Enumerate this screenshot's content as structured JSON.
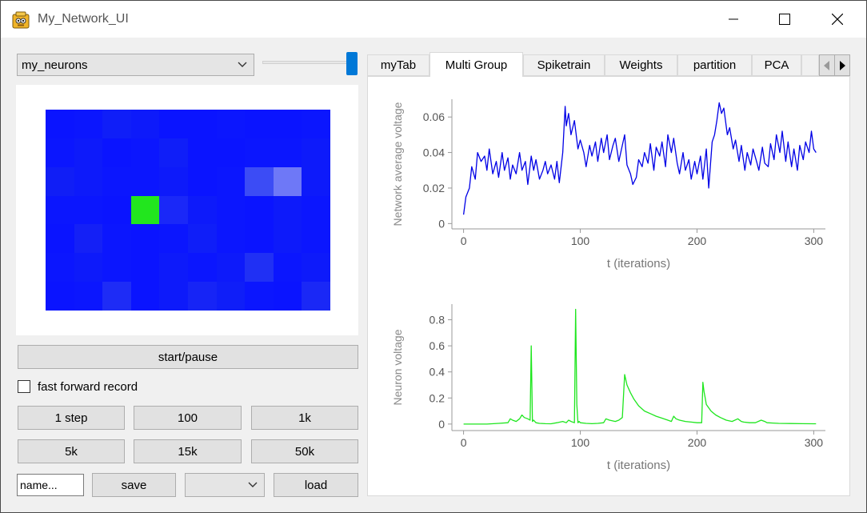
{
  "window": {
    "title": "My_Network_UI"
  },
  "left": {
    "group_select": {
      "value": "my_neurons"
    },
    "slider": {
      "value_fraction": 1.0
    },
    "heatmap": {
      "rows": 7,
      "cols": 10,
      "cells": [
        [
          "#0a14ff",
          "#0b16fe",
          "#0f1ef8",
          "#0d1afa",
          "#0a14ff",
          "#0a14ff",
          "#0b16fe",
          "#0a14ff",
          "#0a14ff",
          "#0b16fe"
        ],
        [
          "#0b16fe",
          "#0d1afa",
          "#0a14ff",
          "#0b16fe",
          "#0f1ef8",
          "#0a14ff",
          "#0a14ff",
          "#0b16fe",
          "#0b16fe",
          "#0d1afa"
        ],
        [
          "#101ef6",
          "#0d1afa",
          "#0b16fe",
          "#0b16fe",
          "#0d1afa",
          "#0a14ff",
          "#0b16fe",
          "#3c4cf5",
          "#6e78f7",
          "#0d1afa"
        ],
        [
          "#0b16fe",
          "#0b16fe",
          "#0a14ff",
          "#22e61e",
          "#1a28f8",
          "#0d1afa",
          "#0b16fe",
          "#0a14ff",
          "#0d1afa",
          "#0b16fe"
        ],
        [
          "#0a14ff",
          "#1420f6",
          "#0b16fe",
          "#0a14ff",
          "#0b16fe",
          "#0f1ef8",
          "#0b16fe",
          "#0a14ff",
          "#0d1afa",
          "#0b16fe"
        ],
        [
          "#0b16fe",
          "#0d1afa",
          "#0b16fe",
          "#0a14ff",
          "#0d1afa",
          "#0b16fe",
          "#0d1afa",
          "#2030f4",
          "#0b16fe",
          "#0d1afa"
        ],
        [
          "#0a14ff",
          "#0b16fe",
          "#1e2cf6",
          "#0a14ff",
          "#0d1afa",
          "#1624f6",
          "#0f1ef8",
          "#0b16fe",
          "#0a14ff",
          "#1a28f6"
        ]
      ]
    },
    "start_pause_label": "start/pause",
    "fast_forward": {
      "label": "fast forward record",
      "checked": false
    },
    "step_buttons": [
      "1 step",
      "100",
      "1k",
      "5k",
      "15k",
      "50k"
    ],
    "name_field": {
      "value": "name..."
    },
    "save_label": "save",
    "file_select": {
      "value": ""
    },
    "load_label": "load"
  },
  "tabs": {
    "items": [
      "myTab",
      "Multi Group",
      "Spiketrain",
      "Weights",
      "partition",
      "PCA"
    ],
    "active": "Multi Group"
  },
  "colors": {
    "voltage_line": "#0000e6",
    "neuron_line": "#1ee61e",
    "highlight_neuron": "#22e61e",
    "slider_handle": "#0078d7"
  },
  "chart_data": [
    {
      "type": "line",
      "xlabel": "t (iterations)",
      "ylabel": "Network average voltage",
      "xlim": [
        -10,
        310
      ],
      "ylim": [
        -0.003,
        0.07
      ],
      "xticks": [
        0,
        100,
        200,
        300
      ],
      "yticks": [
        0,
        0.02,
        0.04,
        0.06
      ],
      "yticklabels": [
        "0",
        "0.02",
        "0.04",
        "0.06"
      ],
      "grid": false,
      "series": [
        {
          "color": "#0000e6",
          "x": [
            0,
            2,
            5,
            7,
            10,
            12,
            15,
            18,
            20,
            22,
            25,
            28,
            30,
            33,
            35,
            38,
            40,
            42,
            45,
            48,
            50,
            53,
            55,
            58,
            60,
            62,
            65,
            68,
            70,
            72,
            75,
            78,
            80,
            82,
            85,
            87,
            88,
            90,
            92,
            95,
            98,
            100,
            103,
            105,
            108,
            110,
            113,
            115,
            118,
            120,
            123,
            125,
            128,
            130,
            133,
            135,
            138,
            140,
            143,
            145,
            148,
            150,
            153,
            155,
            158,
            160,
            163,
            165,
            168,
            170,
            173,
            175,
            178,
            180,
            183,
            185,
            188,
            190,
            193,
            195,
            198,
            200,
            203,
            205,
            208,
            210,
            213,
            215,
            217,
            219,
            221,
            223,
            226,
            228,
            231,
            233,
            236,
            238,
            241,
            243,
            246,
            248,
            251,
            253,
            256,
            258,
            261,
            263,
            266,
            268,
            271,
            273,
            276,
            278,
            281,
            283,
            286,
            288,
            291,
            293,
            296,
            298,
            300,
            302
          ],
          "y": [
            0.005,
            0.015,
            0.02,
            0.032,
            0.025,
            0.04,
            0.035,
            0.038,
            0.03,
            0.042,
            0.028,
            0.035,
            0.026,
            0.04,
            0.03,
            0.037,
            0.025,
            0.033,
            0.028,
            0.04,
            0.03,
            0.035,
            0.022,
            0.038,
            0.03,
            0.036,
            0.025,
            0.03,
            0.035,
            0.028,
            0.033,
            0.025,
            0.035,
            0.023,
            0.04,
            0.066,
            0.055,
            0.062,
            0.05,
            0.058,
            0.042,
            0.047,
            0.04,
            0.032,
            0.044,
            0.038,
            0.046,
            0.035,
            0.048,
            0.04,
            0.05,
            0.036,
            0.044,
            0.048,
            0.035,
            0.041,
            0.05,
            0.033,
            0.028,
            0.022,
            0.026,
            0.036,
            0.032,
            0.04,
            0.034,
            0.045,
            0.03,
            0.043,
            0.038,
            0.046,
            0.032,
            0.05,
            0.04,
            0.048,
            0.034,
            0.028,
            0.04,
            0.03,
            0.036,
            0.025,
            0.035,
            0.028,
            0.038,
            0.025,
            0.042,
            0.02,
            0.046,
            0.05,
            0.058,
            0.068,
            0.062,
            0.065,
            0.05,
            0.054,
            0.042,
            0.047,
            0.035,
            0.044,
            0.03,
            0.04,
            0.033,
            0.042,
            0.035,
            0.03,
            0.043,
            0.034,
            0.032,
            0.045,
            0.036,
            0.05,
            0.04,
            0.052,
            0.035,
            0.046,
            0.032,
            0.042,
            0.03,
            0.044,
            0.036,
            0.046,
            0.04,
            0.052,
            0.042,
            0.04
          ]
        }
      ]
    },
    {
      "type": "line",
      "xlabel": "t (iterations)",
      "ylabel": "Neuron voltage",
      "xlim": [
        -10,
        310
      ],
      "ylim": [
        -0.05,
        0.92
      ],
      "xticks": [
        0,
        100,
        200,
        300
      ],
      "yticks": [
        0,
        0.2,
        0.4,
        0.6,
        0.8
      ],
      "yticklabels": [
        "0",
        "0.2",
        "0.4",
        "0.6",
        "0.8"
      ],
      "grid": false,
      "series": [
        {
          "color": "#1ee61e",
          "x": [
            0,
            10,
            20,
            30,
            38,
            40,
            42,
            45,
            48,
            50,
            52,
            55,
            57,
            58,
            59,
            60,
            62,
            65,
            70,
            75,
            80,
            85,
            88,
            90,
            92,
            95,
            96,
            97,
            98,
            99,
            100,
            105,
            110,
            115,
            120,
            122,
            125,
            130,
            133,
            136,
            138,
            140,
            143,
            146,
            150,
            155,
            160,
            165,
            170,
            175,
            178,
            180,
            182,
            185,
            190,
            195,
            200,
            204,
            205,
            206,
            207,
            208,
            212,
            216,
            220,
            225,
            230,
            235,
            238,
            240,
            245,
            250,
            255,
            258,
            260,
            265,
            270,
            280,
            290,
            300,
            302
          ],
          "y": [
            0,
            0,
            0,
            0.005,
            0.01,
            0.04,
            0.03,
            0.02,
            0.04,
            0.07,
            0.05,
            0.04,
            0.03,
            0.6,
            0.02,
            0.03,
            0.01,
            0.005,
            0.003,
            0.002,
            0.01,
            0.02,
            0.01,
            0.03,
            0.02,
            0.01,
            0.88,
            0.15,
            0.01,
            0.02,
            0.01,
            0.005,
            0.003,
            0.005,
            0.01,
            0.04,
            0.03,
            0.02,
            0.03,
            0.05,
            0.38,
            0.3,
            0.24,
            0.19,
            0.14,
            0.1,
            0.08,
            0.06,
            0.045,
            0.03,
            0.02,
            0.06,
            0.04,
            0.03,
            0.02,
            0.015,
            0.01,
            0.01,
            0.32,
            0.25,
            0.2,
            0.15,
            0.1,
            0.07,
            0.05,
            0.03,
            0.02,
            0.04,
            0.02,
            0.015,
            0.01,
            0.01,
            0.03,
            0.02,
            0.01,
            0.008,
            0.005,
            0.004,
            0.003,
            0.002,
            0.002
          ]
        }
      ]
    }
  ]
}
